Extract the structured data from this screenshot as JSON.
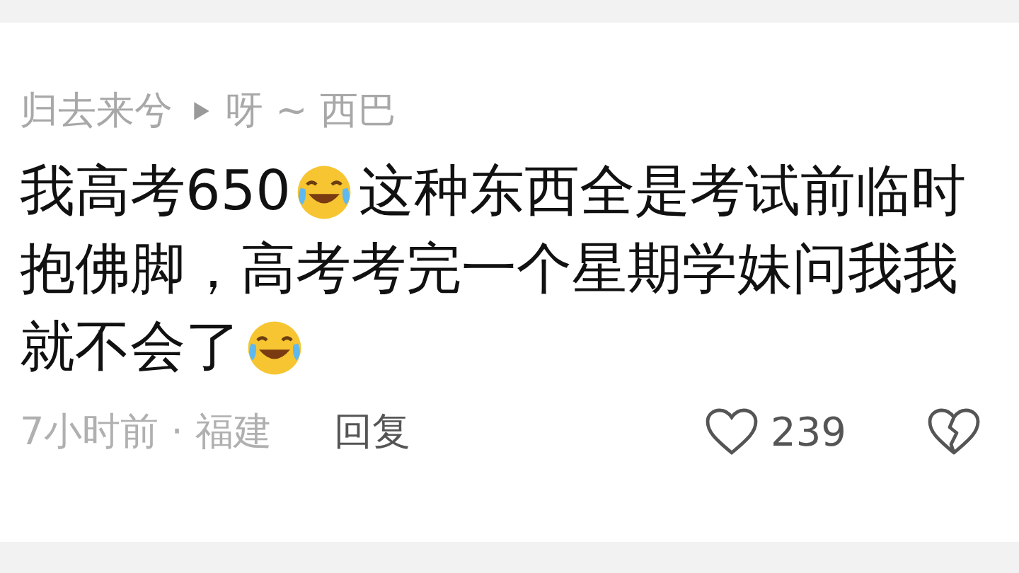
{
  "comment": {
    "author": "归去来兮",
    "reply_to": "呀 ~ 西巴",
    "body_lines": [
      [
        {
          "kind": "text",
          "text": "我高考650"
        },
        {
          "kind": "emoji"
        },
        {
          "kind": "text",
          "text": "这种东西全是考试前临时"
        }
      ],
      [
        {
          "kind": "text",
          "text": "抱佛脚，高考考完一个星期学妹问我我"
        }
      ],
      [
        {
          "kind": "text",
          "text": "就不会了"
        },
        {
          "kind": "emoji"
        }
      ]
    ],
    "meta": "7小时前 · 福建",
    "reply_label": "回复",
    "likes": "239"
  }
}
